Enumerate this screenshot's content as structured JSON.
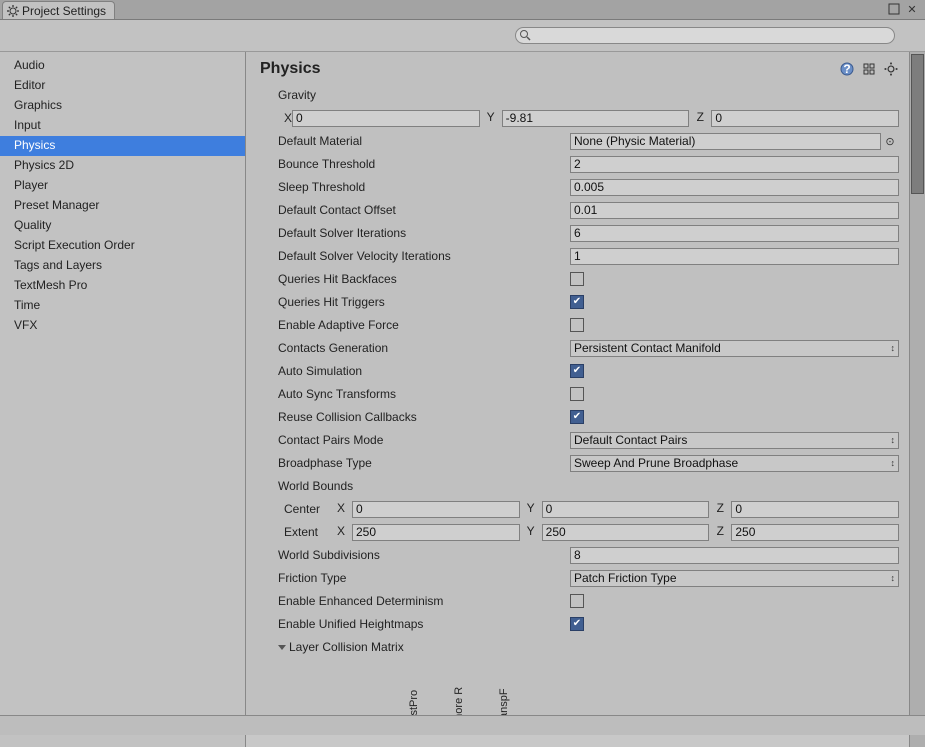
{
  "window": {
    "tab_title": "Project Settings"
  },
  "search": {
    "placeholder": ""
  },
  "categories": [
    {
      "label": "Audio",
      "selected": false
    },
    {
      "label": "Editor",
      "selected": false
    },
    {
      "label": "Graphics",
      "selected": false
    },
    {
      "label": "Input",
      "selected": false
    },
    {
      "label": "Physics",
      "selected": true
    },
    {
      "label": "Physics 2D",
      "selected": false
    },
    {
      "label": "Player",
      "selected": false
    },
    {
      "label": "Preset Manager",
      "selected": false
    },
    {
      "label": "Quality",
      "selected": false
    },
    {
      "label": "Script Execution Order",
      "selected": false
    },
    {
      "label": "Tags and Layers",
      "selected": false
    },
    {
      "label": "TextMesh Pro",
      "selected": false
    },
    {
      "label": "Time",
      "selected": false
    },
    {
      "label": "VFX",
      "selected": false
    }
  ],
  "panel": {
    "title": "Physics",
    "gravity_label": "Gravity",
    "x_label": "X",
    "y_label": "Y",
    "z_label": "Z",
    "gravity": {
      "x": "0",
      "y": "-9.81",
      "z": "0"
    },
    "default_material_label": "Default Material",
    "default_material_value": "None (Physic Material)",
    "bounce_threshold_label": "Bounce Threshold",
    "bounce_threshold_value": "2",
    "sleep_threshold_label": "Sleep Threshold",
    "sleep_threshold_value": "0.005",
    "default_contact_offset_label": "Default Contact Offset",
    "default_contact_offset_value": "0.01",
    "default_solver_iterations_label": "Default Solver Iterations",
    "default_solver_iterations_value": "6",
    "default_solver_velocity_label": "Default Solver Velocity Iterations",
    "default_solver_velocity_value": "1",
    "queries_hit_backfaces_label": "Queries Hit Backfaces",
    "queries_hit_backfaces": false,
    "queries_hit_triggers_label": "Queries Hit Triggers",
    "queries_hit_triggers": true,
    "enable_adaptive_force_label": "Enable Adaptive Force",
    "enable_adaptive_force": false,
    "contacts_generation_label": "Contacts Generation",
    "contacts_generation_value": "Persistent Contact Manifold",
    "auto_simulation_label": "Auto Simulation",
    "auto_simulation": true,
    "auto_sync_transforms_label": "Auto Sync Transforms",
    "auto_sync_transforms": false,
    "reuse_collision_callbacks_label": "Reuse Collision Callbacks",
    "reuse_collision_callbacks": true,
    "contact_pairs_mode_label": "Contact Pairs Mode",
    "contact_pairs_mode_value": "Default Contact Pairs",
    "broadphase_type_label": "Broadphase Type",
    "broadphase_type_value": "Sweep And Prune Broadphase",
    "world_bounds_label": "World Bounds",
    "center_label": "Center",
    "extent_label": "Extent",
    "center": {
      "x": "0",
      "y": "0",
      "z": "0"
    },
    "extent": {
      "x": "250",
      "y": "250",
      "z": "250"
    },
    "world_subdivisions_label": "World Subdivisions",
    "world_subdivisions_value": "8",
    "friction_type_label": "Friction Type",
    "friction_type_value": "Patch Friction Type",
    "enable_enhanced_determinism_label": "Enable Enhanced Determinism",
    "enable_enhanced_determinism": false,
    "enable_unified_heightmaps_label": "Enable Unified Heightmaps",
    "enable_unified_heightmaps": true,
    "layer_collision_matrix_label": "Layer Collision Matrix",
    "matrix_columns": [
      "PostPro",
      "Ignore R",
      "TranspF"
    ]
  }
}
